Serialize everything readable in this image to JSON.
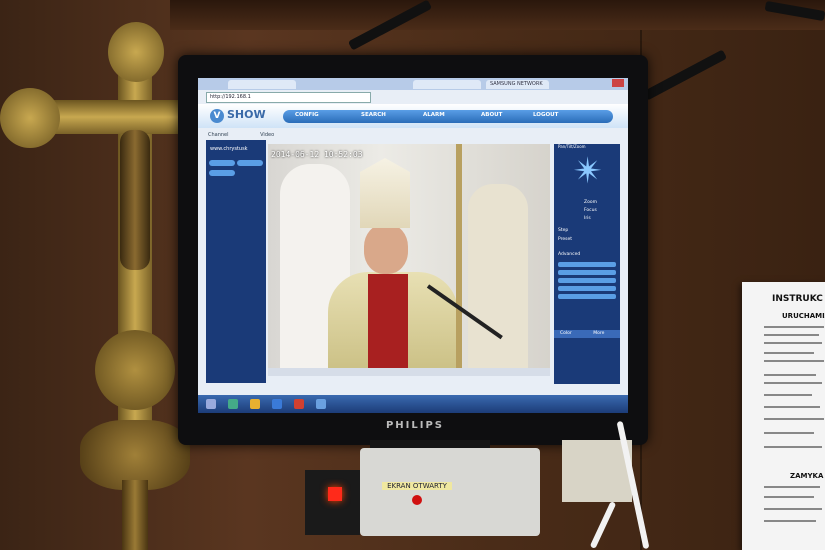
{
  "scene": {
    "browser": {
      "tabs": [
        "",
        "",
        "SAMSUNG NETWORK"
      ],
      "address": "http://192.168.1"
    },
    "app": {
      "logo": "SHOW",
      "logo_letter": "V",
      "nav": [
        "CONFIG",
        "SEARCH",
        "ALARM",
        "ABOUT",
        "LOGOUT"
      ],
      "subtabs": [
        "Channel",
        "Video"
      ],
      "channel_title": "www.chrystusk",
      "video_timestamp": "2014-06-12 10:52:03",
      "ptz_title": "Pan/Tilt/Zoom",
      "ptz_labels": [
        "Zoom",
        "Focus",
        "Iris",
        "Step",
        "Preset",
        "Advanced"
      ],
      "color_tabs": [
        "Color",
        "More"
      ]
    },
    "monitor_brand": "PHILIPS",
    "box_label": "EKRAN OTWARTY",
    "sheet": {
      "title": "INSTRUKC",
      "subtitle": "URUCHAMIA",
      "section2": "ZAMYKA"
    },
    "colors": {
      "wood": "#4a2c18",
      "panel_blue": "#1a3a78",
      "nav_blue": "#2a6cb8",
      "led_red": "#ff2a1a"
    }
  }
}
